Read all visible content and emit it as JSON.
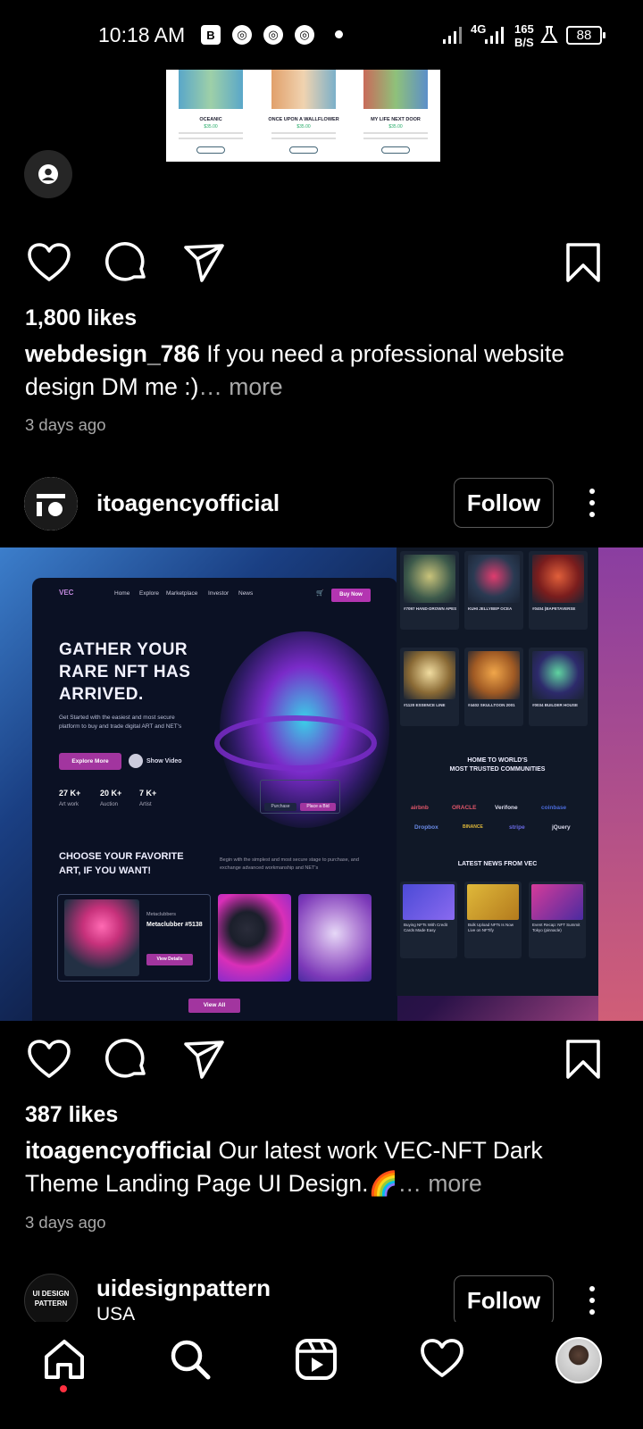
{
  "status_bar": {
    "time": "10:18 AM",
    "notification_icons": [
      "b-icon",
      "chrome-icon",
      "chrome-icon",
      "chrome-icon"
    ],
    "network": "4G",
    "speed_value": "165",
    "speed_unit": "B/S",
    "battery": "88"
  },
  "previous_post": {
    "image_books": [
      {
        "title": "OCEANIC",
        "price": "$35.00"
      },
      {
        "title": "ONCE UPON A WALLFLOWER",
        "price": "$35.00"
      },
      {
        "title": "MY LIFE NEXT DOOR",
        "price": "$35.00"
      }
    ],
    "likes": "1,800 likes",
    "caption_user": "webdesign_786",
    "caption_text": " If you need a professional website design DM me :)",
    "caption_more": "… more",
    "time_ago": "3 days ago"
  },
  "post": {
    "username": "itoagencyofficial",
    "follow_label": "Follow",
    "image": {
      "logo": "VEC",
      "nav": [
        "Home",
        "Explore",
        "Marketplace",
        "Investor",
        "News"
      ],
      "buy_now": "Buy Now",
      "hero_line1": "GATHER YOUR",
      "hero_line2": "RARE NFT HAS",
      "hero_line3": "ARRIVED.",
      "hero_sub": "Get Started with the easiest and most secure platform to buy and trade digital ART and NET's",
      "explore_more": "Explore More",
      "show_video": "Show Video",
      "stats": [
        {
          "num": "27 K+",
          "label": "Art work"
        },
        {
          "num": "20 K+",
          "label": "Auction"
        },
        {
          "num": "7 K+",
          "label": "Artist"
        }
      ],
      "bid_purchase": "Purchase",
      "bid_place": "Place a Bid",
      "choose_line1": "CHOOSE YOUR FAVORITE",
      "choose_line2": "ART, IF YOU WANT!",
      "choose_sub": "Begin with the simplest and most secure stage to purchase, and exchange advanced workmanship and NET's",
      "card_user": "Metaclubbers",
      "card_name": "Metaclubber #5138",
      "view_details": "View Details",
      "view_all": "View All",
      "nft_cards": [
        "#7097 HAND-DROWN APES",
        "KUHI JELLYBEP OCEA",
        "#0404 (BAPETAVERSE",
        "#1120 ESSENCE LINE",
        "#4402 SKULLTOON 2001",
        "#0034 BUILDER HOUSE"
      ],
      "home_title_1": "HOME TO WORLD'S",
      "home_title_2": "MOST TRUSTED COMMUNITIES",
      "brands_row1": [
        "airbnb",
        "ORACLE",
        "Verifone",
        "coinbase"
      ],
      "brands_row2": [
        "Dropbox",
        "BINANCE",
        "stripe",
        "jQuery"
      ],
      "news_title": "LATEST NEWS FROM VEC",
      "news": [
        "Buying NFTs With Credit Cards Made Easy",
        "Bulk Upload NFTs Is Now Live on NFTify",
        "Event Recap: NFT Summit Tokyo (pinnacle)"
      ]
    },
    "likes": "387 likes",
    "caption_user": "itoagencyofficial",
    "caption_text": " Our latest work VEC-NFT Dark Theme Landing Page UI Design.🌈",
    "caption_more": "… more",
    "time_ago": "3 days ago"
  },
  "next_post": {
    "avatar_text_1": "UI DESIGN",
    "avatar_text_2": "PATTERN",
    "username": "uidesignpattern",
    "location": "USA",
    "follow_label": "Follow"
  },
  "bottom_nav": [
    "home-icon",
    "search-icon",
    "reels-icon",
    "activity-heart-icon",
    "profile-avatar"
  ]
}
